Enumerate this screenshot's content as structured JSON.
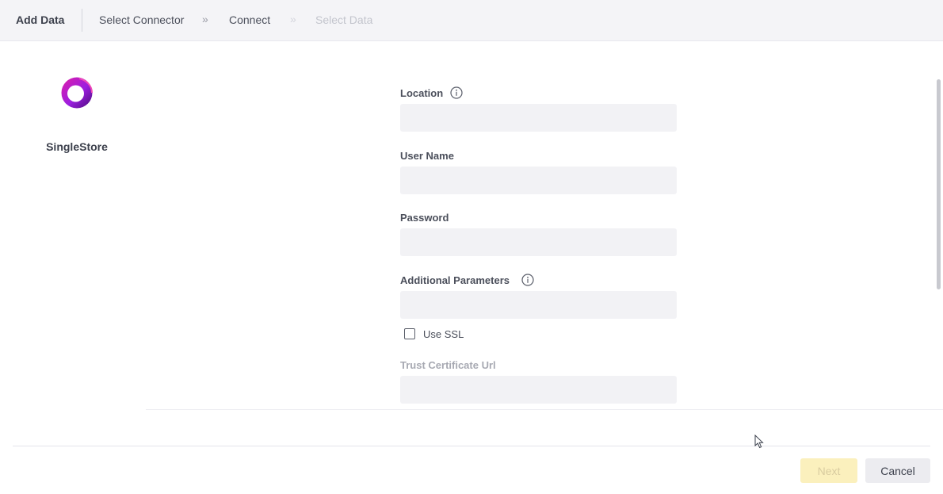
{
  "header": {
    "title": "Add Data",
    "breadcrumbs": [
      {
        "label": "Select Connector",
        "state": "done"
      },
      {
        "label": "Connect",
        "state": "current"
      },
      {
        "label": "Select Data",
        "state": "disabled"
      }
    ]
  },
  "connector": {
    "name": "SingleStore",
    "logo_icon": "singlestore-logo-icon",
    "colors": {
      "logo_start": "#9c1ee0",
      "logo_end": "#e01ea8",
      "logo_dark": "#4a0c7a"
    }
  },
  "form": {
    "location": {
      "label": "Location",
      "value": "",
      "placeholder": ""
    },
    "user_name": {
      "label": "User Name",
      "value": "",
      "placeholder": ""
    },
    "password": {
      "label": "Password",
      "value": "",
      "placeholder": ""
    },
    "additional_parameters": {
      "label": "Additional Parameters",
      "value": "",
      "placeholder": ""
    },
    "use_ssl": {
      "label": "Use SSL",
      "checked": false
    },
    "trust_certificate_url": {
      "label": "Trust Certificate Url",
      "value": "",
      "placeholder": ""
    }
  },
  "footer": {
    "next_label": "Next",
    "cancel_label": "Cancel"
  }
}
